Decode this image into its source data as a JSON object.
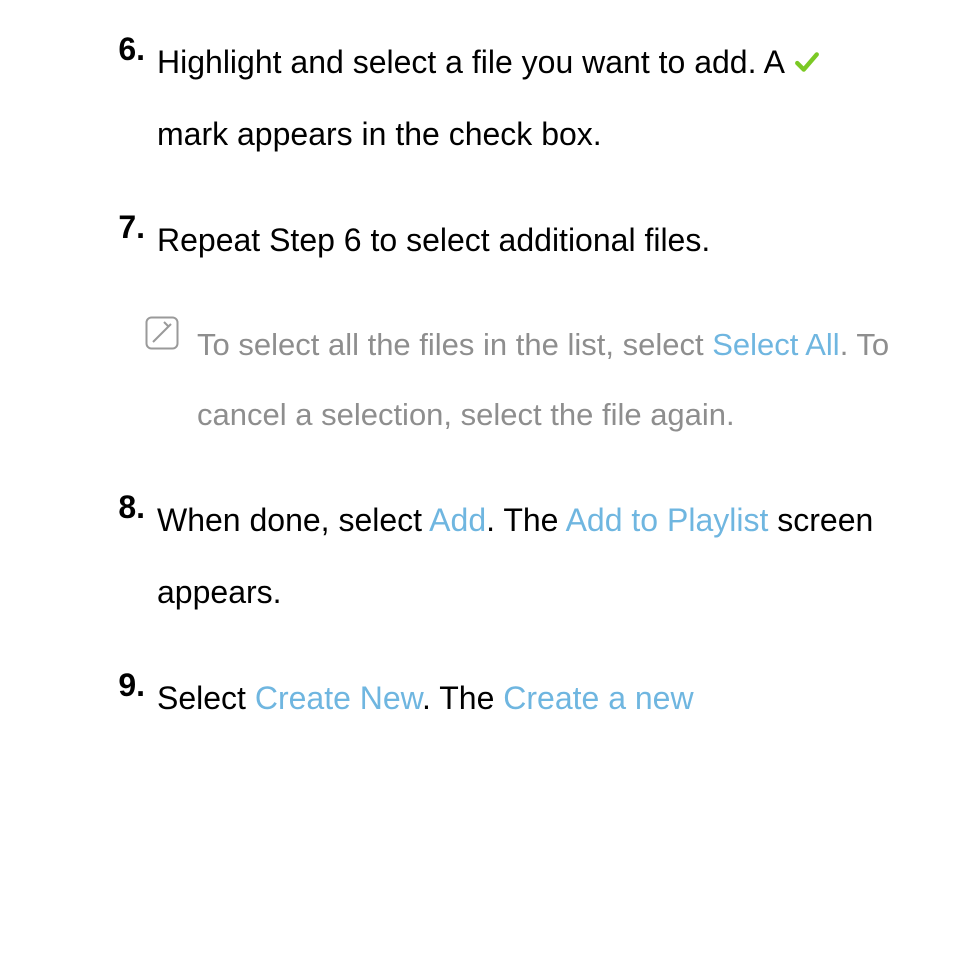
{
  "steps": {
    "s6": {
      "num": "6.",
      "part1": "Highlight and select a file you want to add. A ",
      "part2": " mark appears in the check box."
    },
    "s7": {
      "num": "7.",
      "body": "Repeat Step 6 to select additional files."
    },
    "note": {
      "p1": "To select all the files in the list, select ",
      "hl1": "Select All",
      "p2": ". To cancel a selection, select the file again."
    },
    "s8": {
      "num": "8.",
      "p1": "When done, select ",
      "hl1": "Add",
      "p2": ". The ",
      "hl2": "Add to Playlist",
      "p3": " screen appears."
    },
    "s9": {
      "num": "9.",
      "p1": "Select ",
      "hl1": "Create New",
      "p2": ". The ",
      "hl2": "Create a new"
    }
  }
}
